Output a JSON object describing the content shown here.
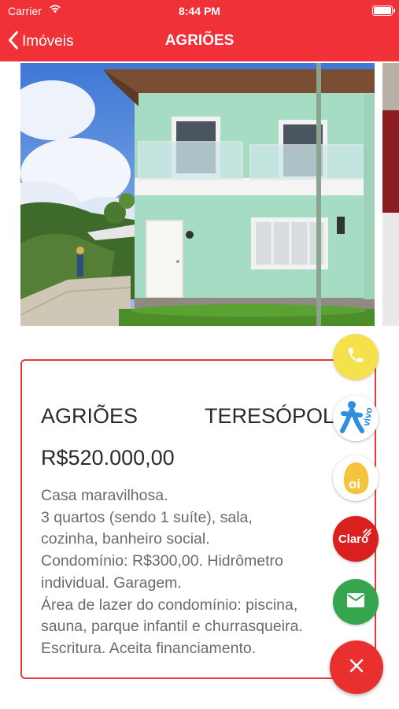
{
  "status_bar": {
    "carrier": "Carrier",
    "time": "8:44 PM",
    "wifi_icon": "wifi-icon",
    "battery_icon": "battery-icon"
  },
  "nav": {
    "back_label": "Imóveis",
    "title": "AGRIÕES"
  },
  "gallery": {
    "image_1": "house-photo",
    "image_2": "next-photo"
  },
  "listing": {
    "neighborhood": "AGRIÕES",
    "city": "TERESÓPOLIS",
    "price": "R$520.000,00",
    "description_lines": [
      "Casa maravilhosa.",
      "3 quartos (sendo 1 suíte), sala,",
      "cozinha, banheiro social.",
      "Condomínio: R$300,00. Hidrômetro",
      "individual. Garagem.",
      "Área de lazer do condomínio: piscina,",
      "sauna, parque infantil e churrasqueira.",
      "Escritura. Aceita financiamento."
    ]
  },
  "fab": {
    "phone_icon": "phone-icon",
    "vivo_label": "vivo",
    "oi_label": "oi",
    "claro_label": "Claro",
    "mail_icon": "mail-icon",
    "close_icon": "close-icon"
  },
  "colors": {
    "brand_red": "#f03238",
    "card_border": "#e63a3a",
    "phone_yellow": "#f5e14c",
    "mail_green": "#35a64e"
  }
}
